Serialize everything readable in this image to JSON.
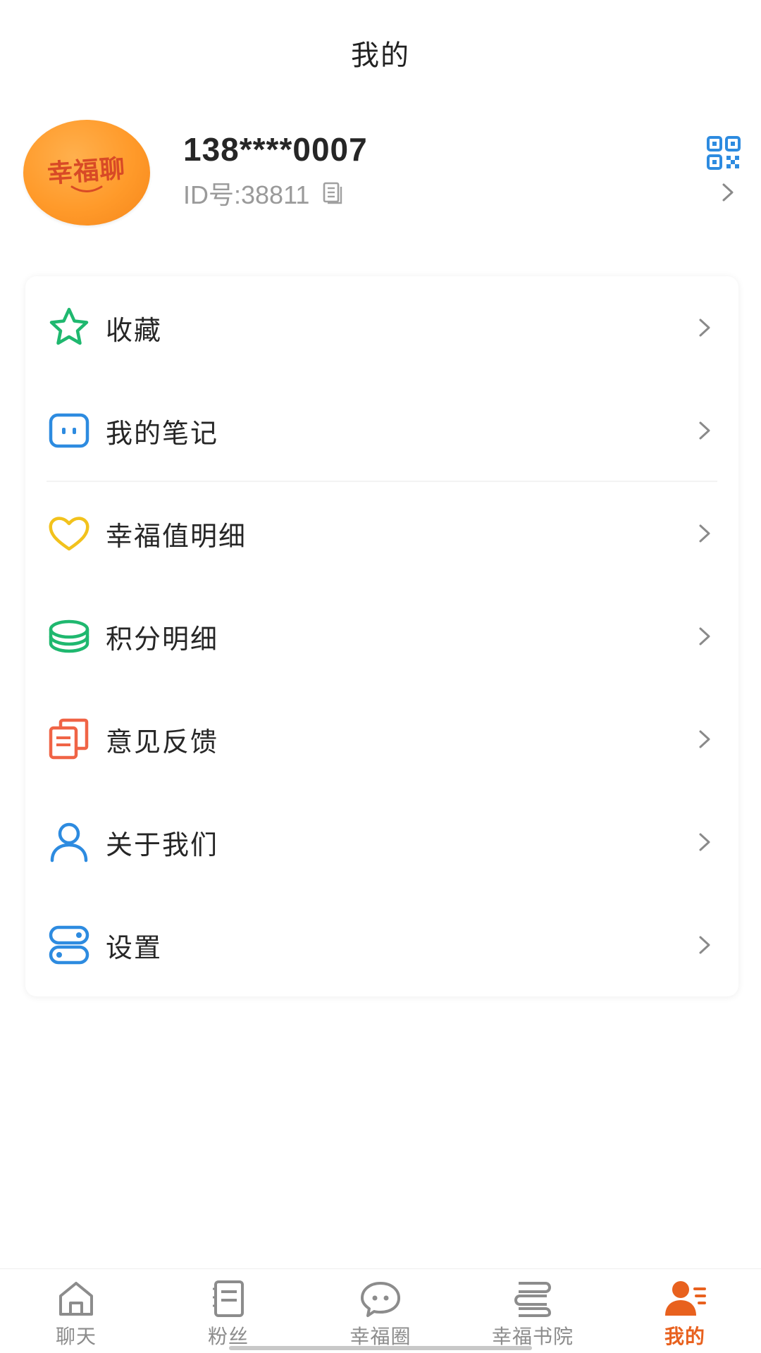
{
  "header": {
    "title": "我的"
  },
  "profile": {
    "avatar_text": "幸福聊",
    "name": "138****0007",
    "id_text": "ID号:38811"
  },
  "menu": {
    "items": [
      {
        "label": "收藏",
        "icon": "star-icon",
        "color": "#1fb86f"
      },
      {
        "label": "我的笔记",
        "icon": "note-chat-icon",
        "color": "#2d8be0"
      },
      {
        "label": "幸福值明细",
        "icon": "heart-icon",
        "color": "#f2c21c"
      },
      {
        "label": "积分明细",
        "icon": "coin-stack-icon",
        "color": "#1fb86f"
      },
      {
        "label": "意见反馈",
        "icon": "feedback-doc-icon",
        "color": "#f06446"
      },
      {
        "label": "关于我们",
        "icon": "user-icon",
        "color": "#2d8be0"
      },
      {
        "label": "设置",
        "icon": "settings-toggle-icon",
        "color": "#2d8be0"
      }
    ]
  },
  "tabbar": {
    "tabs": [
      {
        "label": "聊天",
        "icon": "home-icon",
        "active": false
      },
      {
        "label": "粉丝",
        "icon": "notebook-icon",
        "active": false
      },
      {
        "label": "幸福圈",
        "icon": "chat-bubble-icon",
        "active": false
      },
      {
        "label": "幸福书院",
        "icon": "books-icon",
        "active": false
      },
      {
        "label": "我的",
        "icon": "profile-icon",
        "active": true
      }
    ]
  },
  "colors": {
    "accent": "#e8611e",
    "avatar_orange": "#ff9a2a",
    "qr_blue": "#2d8be0",
    "inactive_tab": "#8c8c8c"
  }
}
